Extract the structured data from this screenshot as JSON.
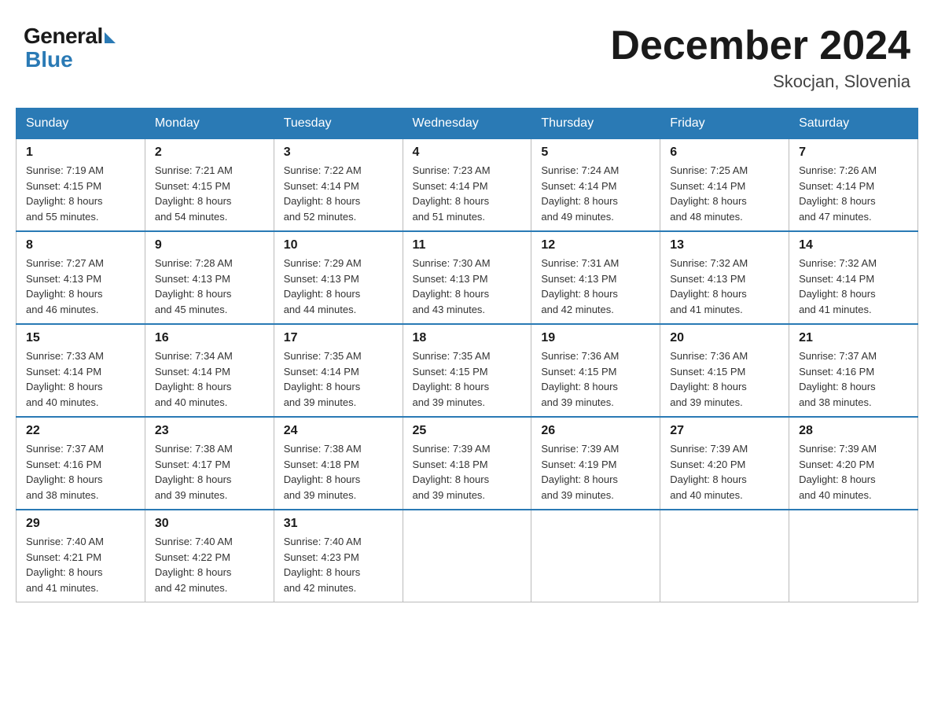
{
  "header": {
    "title": "December 2024",
    "location": "Skocjan, Slovenia",
    "logo_general": "General",
    "logo_blue": "Blue"
  },
  "weekdays": [
    "Sunday",
    "Monday",
    "Tuesday",
    "Wednesday",
    "Thursday",
    "Friday",
    "Saturday"
  ],
  "weeks": [
    [
      {
        "day": "1",
        "sunrise": "7:19 AM",
        "sunset": "4:15 PM",
        "daylight": "8 hours and 55 minutes."
      },
      {
        "day": "2",
        "sunrise": "7:21 AM",
        "sunset": "4:15 PM",
        "daylight": "8 hours and 54 minutes."
      },
      {
        "day": "3",
        "sunrise": "7:22 AM",
        "sunset": "4:14 PM",
        "daylight": "8 hours and 52 minutes."
      },
      {
        "day": "4",
        "sunrise": "7:23 AM",
        "sunset": "4:14 PM",
        "daylight": "8 hours and 51 minutes."
      },
      {
        "day": "5",
        "sunrise": "7:24 AM",
        "sunset": "4:14 PM",
        "daylight": "8 hours and 49 minutes."
      },
      {
        "day": "6",
        "sunrise": "7:25 AM",
        "sunset": "4:14 PM",
        "daylight": "8 hours and 48 minutes."
      },
      {
        "day": "7",
        "sunrise": "7:26 AM",
        "sunset": "4:14 PM",
        "daylight": "8 hours and 47 minutes."
      }
    ],
    [
      {
        "day": "8",
        "sunrise": "7:27 AM",
        "sunset": "4:13 PM",
        "daylight": "8 hours and 46 minutes."
      },
      {
        "day": "9",
        "sunrise": "7:28 AM",
        "sunset": "4:13 PM",
        "daylight": "8 hours and 45 minutes."
      },
      {
        "day": "10",
        "sunrise": "7:29 AM",
        "sunset": "4:13 PM",
        "daylight": "8 hours and 44 minutes."
      },
      {
        "day": "11",
        "sunrise": "7:30 AM",
        "sunset": "4:13 PM",
        "daylight": "8 hours and 43 minutes."
      },
      {
        "day": "12",
        "sunrise": "7:31 AM",
        "sunset": "4:13 PM",
        "daylight": "8 hours and 42 minutes."
      },
      {
        "day": "13",
        "sunrise": "7:32 AM",
        "sunset": "4:13 PM",
        "daylight": "8 hours and 41 minutes."
      },
      {
        "day": "14",
        "sunrise": "7:32 AM",
        "sunset": "4:14 PM",
        "daylight": "8 hours and 41 minutes."
      }
    ],
    [
      {
        "day": "15",
        "sunrise": "7:33 AM",
        "sunset": "4:14 PM",
        "daylight": "8 hours and 40 minutes."
      },
      {
        "day": "16",
        "sunrise": "7:34 AM",
        "sunset": "4:14 PM",
        "daylight": "8 hours and 40 minutes."
      },
      {
        "day": "17",
        "sunrise": "7:35 AM",
        "sunset": "4:14 PM",
        "daylight": "8 hours and 39 minutes."
      },
      {
        "day": "18",
        "sunrise": "7:35 AM",
        "sunset": "4:15 PM",
        "daylight": "8 hours and 39 minutes."
      },
      {
        "day": "19",
        "sunrise": "7:36 AM",
        "sunset": "4:15 PM",
        "daylight": "8 hours and 39 minutes."
      },
      {
        "day": "20",
        "sunrise": "7:36 AM",
        "sunset": "4:15 PM",
        "daylight": "8 hours and 39 minutes."
      },
      {
        "day": "21",
        "sunrise": "7:37 AM",
        "sunset": "4:16 PM",
        "daylight": "8 hours and 38 minutes."
      }
    ],
    [
      {
        "day": "22",
        "sunrise": "7:37 AM",
        "sunset": "4:16 PM",
        "daylight": "8 hours and 38 minutes."
      },
      {
        "day": "23",
        "sunrise": "7:38 AM",
        "sunset": "4:17 PM",
        "daylight": "8 hours and 39 minutes."
      },
      {
        "day": "24",
        "sunrise": "7:38 AM",
        "sunset": "4:18 PM",
        "daylight": "8 hours and 39 minutes."
      },
      {
        "day": "25",
        "sunrise": "7:39 AM",
        "sunset": "4:18 PM",
        "daylight": "8 hours and 39 minutes."
      },
      {
        "day": "26",
        "sunrise": "7:39 AM",
        "sunset": "4:19 PM",
        "daylight": "8 hours and 39 minutes."
      },
      {
        "day": "27",
        "sunrise": "7:39 AM",
        "sunset": "4:20 PM",
        "daylight": "8 hours and 40 minutes."
      },
      {
        "day": "28",
        "sunrise": "7:39 AM",
        "sunset": "4:20 PM",
        "daylight": "8 hours and 40 minutes."
      }
    ],
    [
      {
        "day": "29",
        "sunrise": "7:40 AM",
        "sunset": "4:21 PM",
        "daylight": "8 hours and 41 minutes."
      },
      {
        "day": "30",
        "sunrise": "7:40 AM",
        "sunset": "4:22 PM",
        "daylight": "8 hours and 42 minutes."
      },
      {
        "day": "31",
        "sunrise": "7:40 AM",
        "sunset": "4:23 PM",
        "daylight": "8 hours and 42 minutes."
      },
      null,
      null,
      null,
      null
    ]
  ],
  "labels": {
    "sunrise": "Sunrise:",
    "sunset": "Sunset:",
    "daylight": "Daylight:"
  }
}
